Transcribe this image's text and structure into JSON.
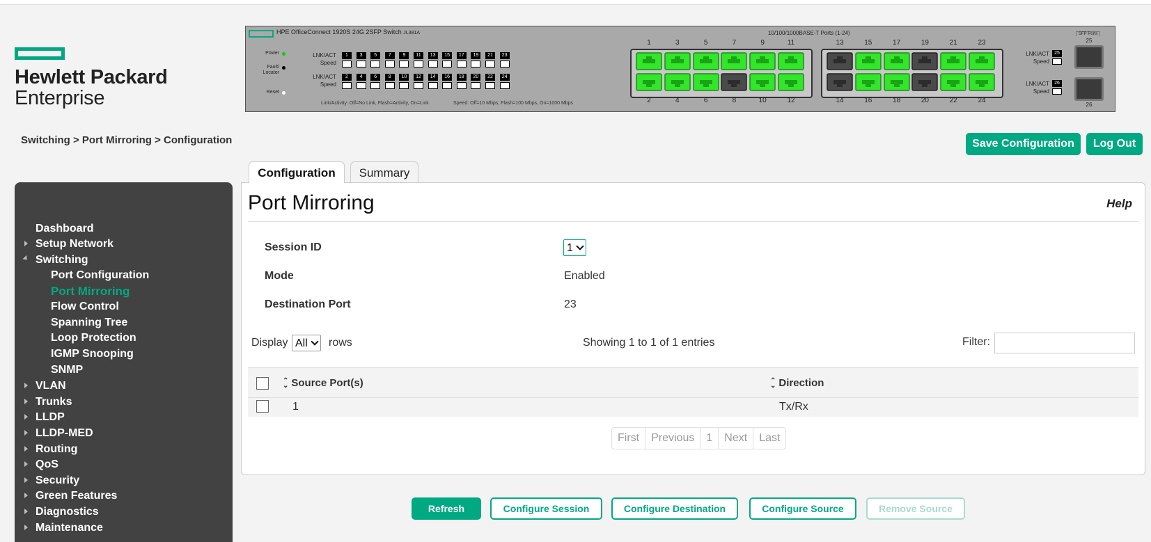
{
  "brand": {
    "line1": "Hewlett Packard",
    "line2": "Enterprise",
    "accent_color": "#01a982"
  },
  "device_panel": {
    "title": "HPE OfficeConnect 1920S 24G 2SFP Switch",
    "model": "JL381A",
    "ports_title": "10/100/1000BASE-T Ports (1-24)",
    "sfp_title": "SFP Ports",
    "led_power": "Power",
    "led_fault": "Fault/ Locator",
    "led_reset": "Reset",
    "lnk_act": "LNK/ACT",
    "speed": "Speed",
    "legend_activity": "Link/Activity: Off=No Link, Flash=Activity, On=Link",
    "legend_speed": "Speed: Off=10 Mbps, Flash=100 Mbps, On=1000 Mbps",
    "odd_leds": [
      "1",
      "3",
      "5",
      "7",
      "9",
      "11",
      "13",
      "15",
      "17",
      "19",
      "21",
      "23"
    ],
    "even_leds": [
      "2",
      "4",
      "6",
      "8",
      "10",
      "12",
      "14",
      "16",
      "18",
      "20",
      "22",
      "24"
    ],
    "top_port_labels": [
      "1",
      "3",
      "5",
      "7",
      "9",
      "11",
      "13",
      "15",
      "17",
      "19",
      "21",
      "23"
    ],
    "bottom_port_labels": [
      "2",
      "4",
      "6",
      "8",
      "10",
      "12",
      "14",
      "16",
      "18",
      "20",
      "22",
      "24"
    ],
    "top_port_status": [
      "up",
      "up",
      "up",
      "up",
      "up",
      "up",
      "down",
      "up",
      "up",
      "down",
      "up",
      "up"
    ],
    "bottom_port_status": [
      "up",
      "up",
      "up",
      "down",
      "up",
      "up",
      "down",
      "up",
      "up",
      "down",
      "up",
      "up"
    ],
    "sfp_ports": [
      "25",
      "26"
    ]
  },
  "breadcrumb": "Switching > Port Mirroring > Configuration",
  "header_buttons": {
    "save": "Save Configuration",
    "logout": "Log Out"
  },
  "sidebar": {
    "items": [
      {
        "label": "Dashboard"
      },
      {
        "label": "Setup Network"
      },
      {
        "label": "Switching"
      },
      {
        "label": "Port Configuration"
      },
      {
        "label": "Port Mirroring"
      },
      {
        "label": "Flow Control"
      },
      {
        "label": "Spanning Tree"
      },
      {
        "label": "Loop Protection"
      },
      {
        "label": "IGMP Snooping"
      },
      {
        "label": "SNMP"
      },
      {
        "label": "VLAN"
      },
      {
        "label": "Trunks"
      },
      {
        "label": "LLDP"
      },
      {
        "label": "LLDP-MED"
      },
      {
        "label": "Routing"
      },
      {
        "label": "QoS"
      },
      {
        "label": "Security"
      },
      {
        "label": "Green Features"
      },
      {
        "label": "Diagnostics"
      },
      {
        "label": "Maintenance"
      }
    ]
  },
  "tabs": [
    {
      "label": "Configuration"
    },
    {
      "label": "Summary"
    }
  ],
  "main": {
    "title": "Port Mirroring",
    "help": "Help",
    "session_id_label": "Session ID",
    "session_id_value": "1",
    "mode_label": "Mode",
    "mode_value": "Enabled",
    "dest_port_label": "Destination Port",
    "dest_port_value": "23",
    "display_label": "Display",
    "display_value": "All",
    "rows_label": "rows",
    "showing": "Showing 1 to 1 of 1 entries",
    "filter_label": "Filter:",
    "filter_value": "",
    "table": {
      "columns": [
        "Source Port(s)",
        "Direction"
      ],
      "rows": [
        {
          "source": "1",
          "direction": "Tx/Rx"
        }
      ]
    },
    "pager": [
      "First",
      "Previous",
      "1",
      "Next",
      "Last"
    ]
  },
  "actions": {
    "refresh": "Refresh",
    "configure_session": "Configure Session",
    "configure_destination": "Configure Destination",
    "configure_source": "Configure Source",
    "remove_source": "Remove Source"
  }
}
